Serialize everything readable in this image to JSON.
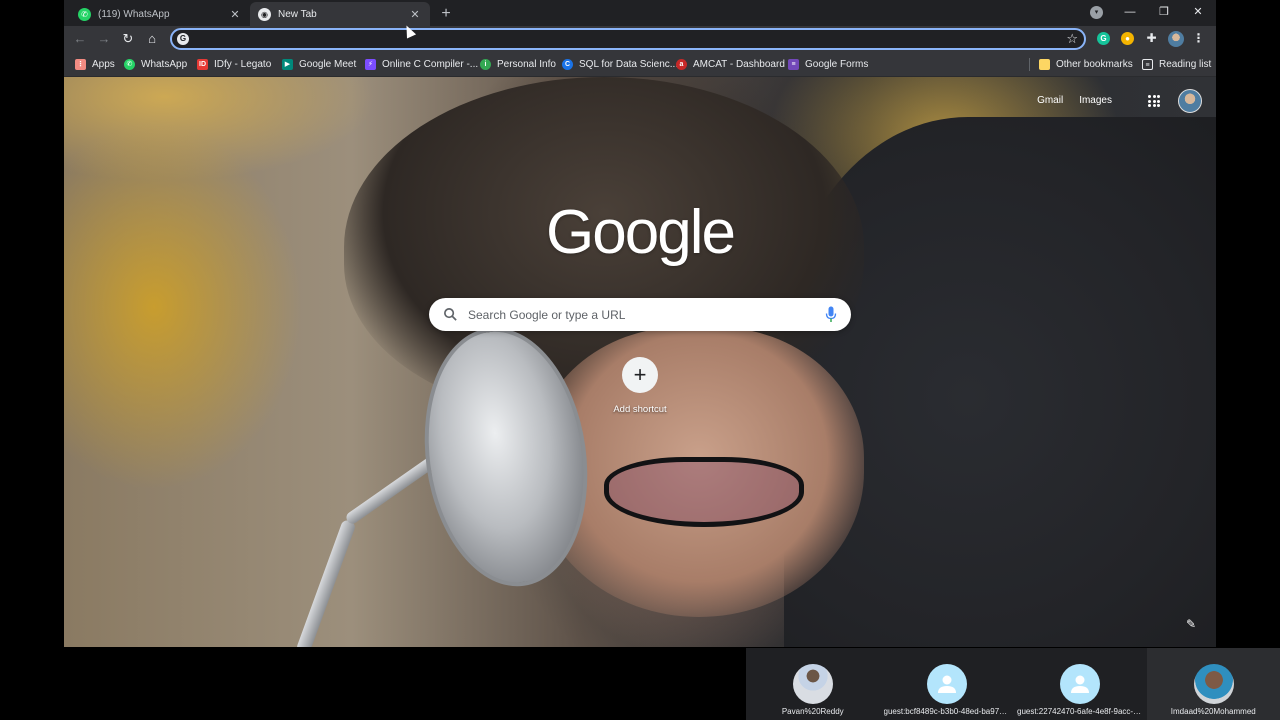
{
  "tabs": [
    {
      "title": "(119) WhatsApp",
      "favicon": "whatsapp-icon",
      "favicon_color": "#25d366",
      "active": false
    },
    {
      "title": "New Tab",
      "favicon": "chrome-icon",
      "favicon_color": "#e8eaed",
      "active": true
    }
  ],
  "omnibox": {
    "value": "",
    "placeholder": ""
  },
  "bookmarks": [
    {
      "label": "Apps",
      "icon": "apps-grid-icon",
      "color": "#f28b82"
    },
    {
      "label": "WhatsApp",
      "icon": "whatsapp-icon",
      "color": "#25d366"
    },
    {
      "label": "IDfy - Legato",
      "icon": "idfy-icon",
      "color": "#e53935"
    },
    {
      "label": "Google Meet",
      "icon": "google-meet-icon",
      "color": "#00897b"
    },
    {
      "label": "Online C Compiler -...",
      "icon": "compiler-icon",
      "color": "#7c4dff"
    },
    {
      "label": "Personal Info",
      "icon": "personal-info-icon",
      "color": "#34a853"
    },
    {
      "label": "SQL for Data Scienc...",
      "icon": "coursera-icon",
      "color": "#1a73e8"
    },
    {
      "label": "AMCAT - Dashboard",
      "icon": "amcat-icon",
      "color": "#c62828"
    },
    {
      "label": "Google Forms",
      "icon": "google-forms-icon",
      "color": "#7248b9"
    },
    {
      "label": "Other bookmarks",
      "icon": "folder-icon",
      "color": "#fdd663"
    },
    {
      "label": "Reading list",
      "icon": "reading-list-icon",
      "color": "#e8eaed"
    }
  ],
  "ntp": {
    "gmail_label": "Gmail",
    "images_label": "Images",
    "logo_text": "Google",
    "search_placeholder": "Search Google or type a URL",
    "add_shortcut_label": "Add shortcut"
  },
  "participants": [
    {
      "name": "Pavan%20Reddy",
      "avatar": "photo"
    },
    {
      "name": "guest:bcf8489c-b3b0-48ed-ba97-0...",
      "avatar": "guest"
    },
    {
      "name": "guest:22742470-6afe-4e8f-9acc-dd...",
      "avatar": "guest"
    },
    {
      "name": "Imdaad%20Mohammed",
      "avatar": "photo"
    }
  ],
  "colors": {
    "accent": "#8ab4f8",
    "toolbar": "#35363a",
    "frame": "#202124"
  }
}
